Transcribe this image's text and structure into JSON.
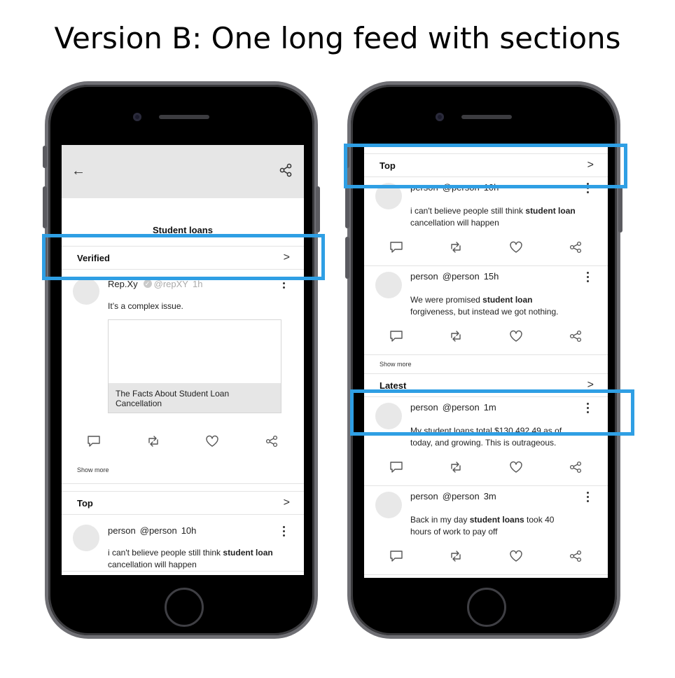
{
  "page_title": "Version B: One long feed with sections",
  "colors": {
    "highlight": "#2f9fe4",
    "appbar": "#e6e6e6"
  },
  "left_phone": {
    "back_icon": "arrow-left-icon",
    "share_icon": "share-icon",
    "feed_title": "Student loans",
    "verified_section": {
      "label": "Verified",
      "chevron": ">"
    },
    "verified_post": {
      "name": "Rep.Xy",
      "handle": "@repXY",
      "time": "1h",
      "text": "It’s a complex issue.",
      "link_caption": "The Facts About Student Loan Cancellation"
    },
    "show_more": "Show more",
    "top_section": {
      "label": "Top",
      "chevron": ">"
    },
    "top_post": {
      "name": "person",
      "handle": "@person",
      "time": "10h",
      "text_before": "i can't believe people still think ",
      "text_bold": "student loan",
      "text_after": " cancellation will happen"
    }
  },
  "right_phone": {
    "top_section": {
      "label": "Top",
      "chevron": ">"
    },
    "posts_top": [
      {
        "name": "person",
        "handle": "@person",
        "time": "10h",
        "text_before": "i can't believe people still think ",
        "text_bold": "student loan",
        "text_after": " cancellation will happen"
      },
      {
        "name": "person",
        "handle": "@person",
        "time": "15h",
        "text_before": "We were promised ",
        "text_bold": "student loan",
        "text_after": " forgiveness, but instead we got nothing."
      }
    ],
    "show_more": "Show more",
    "latest_section": {
      "label": "Latest",
      "chevron": ">"
    },
    "posts_latest": [
      {
        "name": "person",
        "handle": "@person",
        "time": "1m",
        "text_before": "My student loans total $130,492.49 as of today, and growing. This is outrageous.",
        "text_bold": "",
        "text_after": ""
      },
      {
        "name": "person",
        "handle": "@person",
        "time": "3m",
        "text_before": "Back in my day ",
        "text_bold": "student loans",
        "text_after": " took 40 hours of work to pay off"
      }
    ]
  }
}
